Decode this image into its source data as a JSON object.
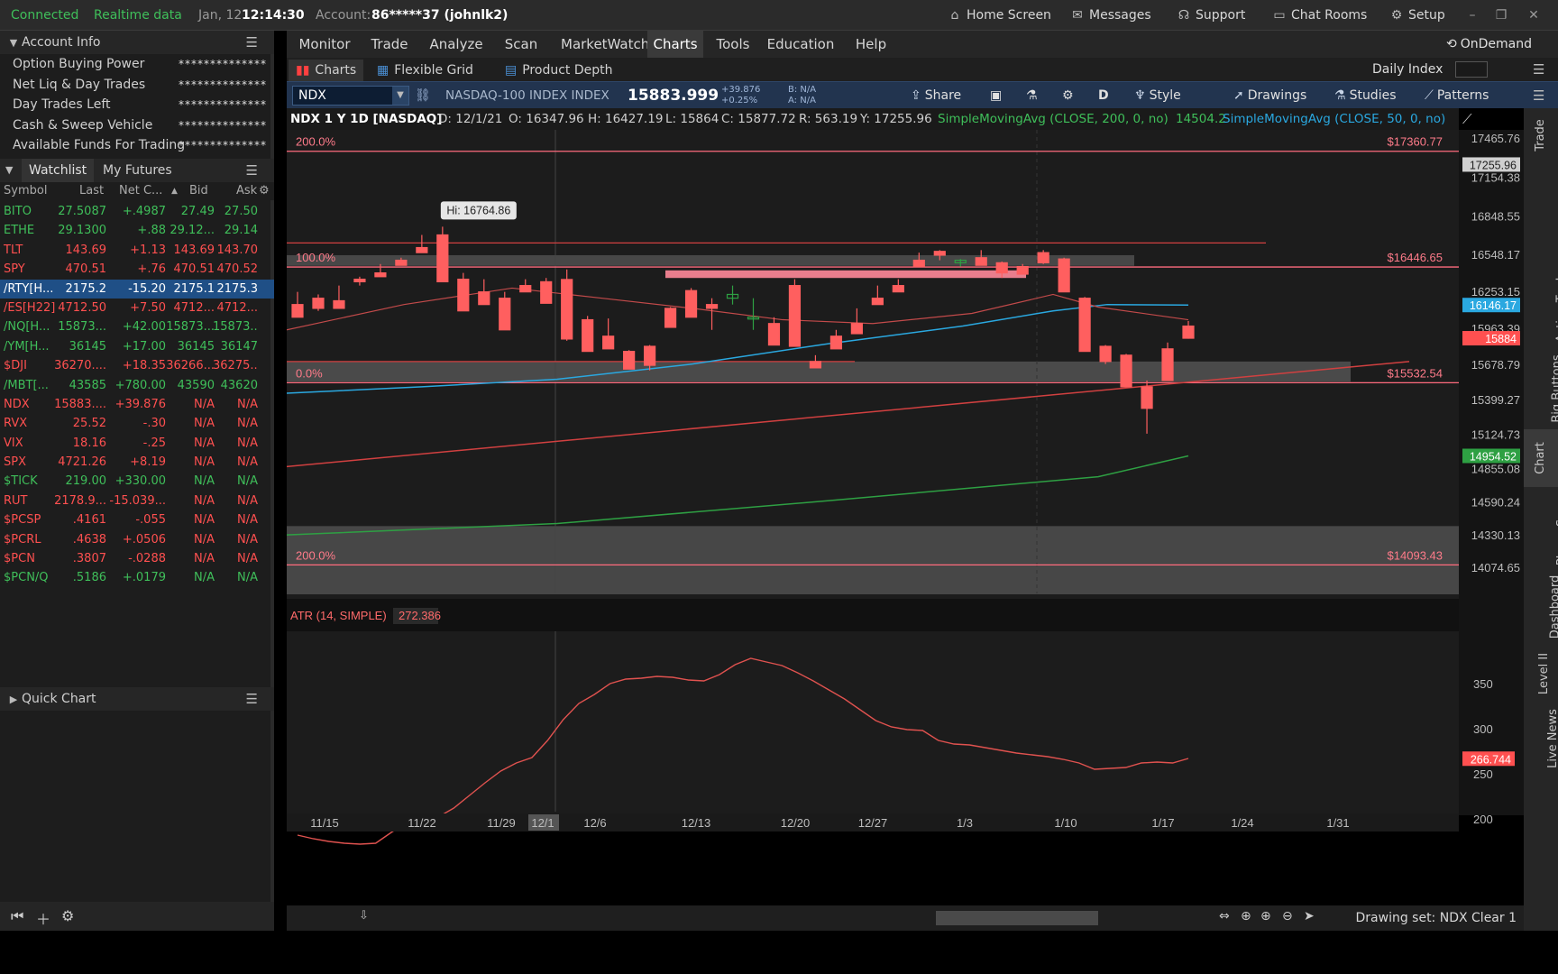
{
  "status": {
    "connected": "Connected",
    "realtime": "Realtime data",
    "date": "Jan, 12",
    "time": "12:14:30",
    "account_label": "Account:",
    "account_value": "86*****37 (johnlk2)"
  },
  "top_buttons": {
    "home": "Home Screen",
    "messages": "Messages",
    "support": "Support",
    "chat": "Chat Rooms",
    "setup": "Setup"
  },
  "account_info": {
    "title": "Account Info",
    "rows": [
      {
        "label": "Option Buying Power",
        "value": "**************"
      },
      {
        "label": "Net Liq & Day Trades",
        "value": "**************"
      },
      {
        "label": "Day Trades Left",
        "value": "**************"
      },
      {
        "label": "Cash & Sweep Vehicle",
        "value": "**************"
      },
      {
        "label": "Available Funds For Trading",
        "value": "**************"
      }
    ]
  },
  "watchlist": {
    "tab1": "Watchlist",
    "tab2": "My Futures",
    "headers": {
      "symbol": "Symbol",
      "last": "Last",
      "net": "Net C...",
      "bid": "Bid",
      "ask": "Ask"
    },
    "rows": [
      {
        "symbol": "BITO",
        "last": "27.5087",
        "net": "+.4987",
        "bid": "27.49",
        "ask": "27.50",
        "color": "#3fbf5a"
      },
      {
        "symbol": "ETHE",
        "last": "29.1300",
        "net": "+.88",
        "bid": "29.12...",
        "ask": "29.14",
        "color": "#3fbf5a"
      },
      {
        "symbol": "TLT",
        "last": "143.69",
        "net": "+1.13",
        "bid": "143.69",
        "ask": "143.70",
        "color": "#ff5050"
      },
      {
        "symbol": "SPY",
        "last": "470.51",
        "net": "+.76",
        "bid": "470.51",
        "ask": "470.52",
        "color": "#ff5050"
      },
      {
        "symbol": "/RTY[H...",
        "last": "2175.2",
        "net": "-15.20",
        "bid": "2175.1",
        "ask": "2175.3",
        "color": "#ffffff"
      },
      {
        "symbol": "/ES[H22]",
        "last": "4712.50",
        "net": "+7.50",
        "bid": "4712...",
        "ask": "4712...",
        "color": "#ff5050"
      },
      {
        "symbol": "/NQ[H...",
        "last": "15873...",
        "net": "+42.00",
        "bid": "15873...",
        "ask": "15873...",
        "color": "#3fbf5a"
      },
      {
        "symbol": "/YM[H...",
        "last": "36145",
        "net": "+17.00",
        "bid": "36145",
        "ask": "36147",
        "color": "#3fbf5a"
      },
      {
        "symbol": "$DJI",
        "last": "36270....",
        "net": "+18.35",
        "bid": "36266...",
        "ask": "36275...",
        "color": "#ff5050"
      },
      {
        "symbol": "/MBT[...",
        "last": "43585",
        "net": "+780.00",
        "bid": "43590",
        "ask": "43620",
        "color": "#3fbf5a"
      },
      {
        "symbol": "NDX",
        "last": "15883....",
        "net": "+39.876",
        "bid": "N/A",
        "ask": "N/A",
        "color": "#ff5050"
      },
      {
        "symbol": "RVX",
        "last": "25.52",
        "net": "-.30",
        "bid": "N/A",
        "ask": "N/A",
        "color": "#ff5050"
      },
      {
        "symbol": "VIX",
        "last": "18.16",
        "net": "-.25",
        "bid": "N/A",
        "ask": "N/A",
        "color": "#ff5050"
      },
      {
        "symbol": "SPX",
        "last": "4721.26",
        "net": "+8.19",
        "bid": "N/A",
        "ask": "N/A",
        "color": "#ff5050"
      },
      {
        "symbol": "$TICK",
        "last": "219.00",
        "net": "+330.00",
        "bid": "N/A",
        "ask": "N/A",
        "color": "#3fbf5a"
      },
      {
        "symbol": "RUT",
        "last": "2178.9...",
        "net": "-15.039...",
        "bid": "N/A",
        "ask": "N/A",
        "color": "#ff5050"
      },
      {
        "symbol": "$PCSP",
        "last": ".4161",
        "net": "-.055",
        "bid": "N/A",
        "ask": "N/A",
        "color": "#ff5050"
      },
      {
        "symbol": "$PCRL",
        "last": ".4638",
        "net": "+.0506",
        "bid": "N/A",
        "ask": "N/A",
        "color": "#ff5050"
      },
      {
        "symbol": "$PCN",
        "last": ".3807",
        "net": "-.0288",
        "bid": "N/A",
        "ask": "N/A",
        "color": "#ff5050"
      },
      {
        "symbol": "$PCN/Q",
        "last": ".5186",
        "net": "+.0179",
        "bid": "N/A",
        "ask": "N/A",
        "color": "#3fbf5a"
      }
    ]
  },
  "quick_chart": {
    "title": "Quick Chart"
  },
  "menu": [
    "Monitor",
    "Trade",
    "Analyze",
    "Scan",
    "MarketWatch",
    "Charts",
    "Tools",
    "Education",
    "Help"
  ],
  "menu_active": "Charts",
  "ondemand": "OnDemand",
  "subtabs": {
    "charts": "Charts",
    "flexible": "Flexible Grid",
    "depth": "Product Depth",
    "daily_index": "Daily Index"
  },
  "symbol_bar": {
    "symbol": "NDX",
    "name": "NASDAQ-100 INDEX INDEX",
    "price": "15883.999",
    "change": "+39.876",
    "change_pct": "+0.25%",
    "bid": "B: N/A",
    "ask": "A: N/A",
    "share": "Share",
    "period": "D",
    "style": "Style",
    "drawings": "Drawings",
    "studies": "Studies",
    "patterns": "Patterns"
  },
  "chart_header": {
    "title": "NDX 1 Y 1D [NASDAQ]",
    "date": "D: 12/1/21",
    "open": "O: 16347.96",
    "high": "H: 16427.19",
    "low": "L: 15864",
    "close": "C: 15877.72",
    "range": "R: 563.19",
    "y": "Y: 17255.96",
    "sma200": "SimpleMovingAvg (CLOSE, 200, 0, no)",
    "sma200_value": "14504.2",
    "sma50": "SimpleMovingAvg (CLOSE, 50, 0, no)"
  },
  "chart_data": {
    "type": "candlestick",
    "price_axis": [
      17465.76,
      17154.38,
      16848.55,
      16548.17,
      16253.15,
      15963.39,
      15678.79,
      15399.27,
      15124.73,
      14855.08,
      14590.24,
      14330.13,
      14074.65
    ],
    "price_labels": [
      "17465.76",
      "17154.38",
      "16848.55",
      "16548.17",
      "16253.15",
      "15963.39",
      "15678.79",
      "15399.27",
      "15124.73",
      "14855.08",
      "14590.24",
      "14330.13",
      "14074.65"
    ],
    "date_ticks": [
      "11/15",
      "11/22",
      "11/29",
      "12/1",
      "12/6",
      "12/13",
      "12/20",
      "12/27",
      "1/3",
      "1/10",
      "1/17",
      "1/24",
      "1/31"
    ],
    "hi_label": "Hi: 16764.86",
    "fib_levels": [
      {
        "label": "200.0%",
        "price_label": "$17360.77",
        "value": 17360.77
      },
      {
        "label": "100.0%",
        "price_label": "$16446.65",
        "value": 16446.65
      },
      {
        "label": "0.0%",
        "price_label": "$15532.54",
        "value": 15532.54
      },
      {
        "label": "200.0%",
        "price_label": "$14093.43",
        "value": 14093.43
      }
    ],
    "price_markers": [
      {
        "label": "17255.96",
        "value": 17255.96,
        "color": "#d0d0d0"
      },
      {
        "label": "16146.17",
        "value": 16146.17,
        "color": "#2aa8e0"
      },
      {
        "label": "15884",
        "value": 15884,
        "color": "#ff5050"
      },
      {
        "label": "14954.52",
        "value": 14954.52,
        "color": "#2ea043"
      }
    ],
    "candles": [
      [
        16150,
        16250,
        16080,
        16050
      ],
      [
        16200,
        16230,
        16100,
        16120
      ],
      [
        16180,
        16300,
        16150,
        16120
      ],
      [
        16350,
        16370,
        16300,
        16330
      ],
      [
        16400,
        16470,
        16380,
        16370
      ],
      [
        16500,
        16520,
        16460,
        16460
      ],
      [
        16600,
        16700,
        16580,
        16560
      ],
      [
        16700,
        16764.86,
        16350,
        16330
      ],
      [
        16350,
        16400,
        16340,
        16100
      ],
      [
        16250,
        16350,
        16230,
        16150
      ],
      [
        16200,
        16250,
        15950,
        15950
      ],
      [
        16300,
        16350,
        16250,
        16250
      ],
      [
        16330,
        16360,
        16180,
        16160
      ],
      [
        16347.96,
        16427.19,
        15864,
        15877.72
      ],
      [
        16030,
        16060,
        15820,
        15780
      ],
      [
        15900,
        16040,
        15800,
        15800
      ],
      [
        15780,
        15790,
        15650,
        15640
      ],
      [
        15820,
        15830,
        15630,
        15670
      ],
      [
        16120,
        16130,
        16050,
        15970
      ],
      [
        16260,
        16280,
        16050,
        16050
      ],
      [
        16150,
        16200,
        15950,
        16120
      ],
      [
        16200,
        16300,
        16150,
        16230
      ],
      [
        16050,
        16200,
        15950,
        16050
      ],
      [
        16000,
        16050,
        15850,
        15830
      ],
      [
        16300,
        16350,
        16200,
        15820
      ],
      [
        15700,
        15750,
        15650,
        15650
      ],
      [
        15900,
        15950,
        15800,
        15800
      ],
      [
        16000,
        16120,
        15950,
        15920
      ],
      [
        16200,
        16300,
        16150,
        16150
      ],
      [
        16300,
        16350,
        16250,
        16250
      ],
      [
        16500,
        16560,
        16450,
        16450
      ],
      [
        16570,
        16580,
        16500,
        16540
      ],
      [
        16480,
        16510,
        16450,
        16500
      ],
      [
        16520,
        16580,
        16470,
        16460
      ],
      [
        16480,
        16490,
        16360,
        16400
      ],
      [
        16450,
        16470,
        16400,
        16390
      ],
      [
        16560,
        16580,
        16470,
        16480
      ],
      [
        16510,
        16520,
        16250,
        16250
      ],
      [
        16200,
        16210,
        15780,
        15780
      ],
      [
        15820,
        15830,
        15680,
        15700
      ],
      [
        15750,
        15760,
        15500,
        15500
      ],
      [
        15500,
        15550,
        15130,
        15330
      ],
      [
        15800,
        15850,
        15600,
        15550
      ],
      [
        15980,
        16020,
        15880,
        15884
      ]
    ],
    "atr": {
      "label": "ATR (14, SIMPLE)",
      "value_label": "272.386",
      "axis": [
        350,
        300,
        250,
        200
      ],
      "axis_labels": [
        "350",
        "300",
        "250",
        "200"
      ],
      "marker_label": "266.744",
      "marker_value": 266.744,
      "values": [
        182,
        178,
        175,
        173,
        172,
        173,
        185,
        196,
        200,
        202,
        212,
        226,
        240,
        253,
        262,
        268,
        287,
        310,
        328,
        338,
        350,
        355,
        356,
        358,
        357,
        354,
        353,
        360,
        371,
        378,
        374,
        370,
        362,
        353,
        343,
        333,
        321,
        309,
        302,
        299,
        298,
        287,
        283,
        282,
        279,
        276,
        273,
        271,
        269,
        266,
        262,
        255,
        256,
        257,
        262,
        263,
        262,
        267
      ]
    },
    "line_colors": {
      "sma_fast": "#2aa8e0",
      "trend_red": "#d14040",
      "sma_slow": "#2ea043",
      "fib": "#ff6b7e",
      "candle_up": "#2ea043",
      "candle_down": "#ff5f5f",
      "atr": "#e0524f"
    }
  },
  "right_tabs": [
    "Trade",
    "Times And Sales",
    "Active Trader",
    "Big Buttons",
    "Chart",
    "Phase Scores",
    "Dashboard",
    "Level II",
    "Live News"
  ],
  "bottom": {
    "drawing_set": "Drawing set: NDX Clear 1"
  }
}
